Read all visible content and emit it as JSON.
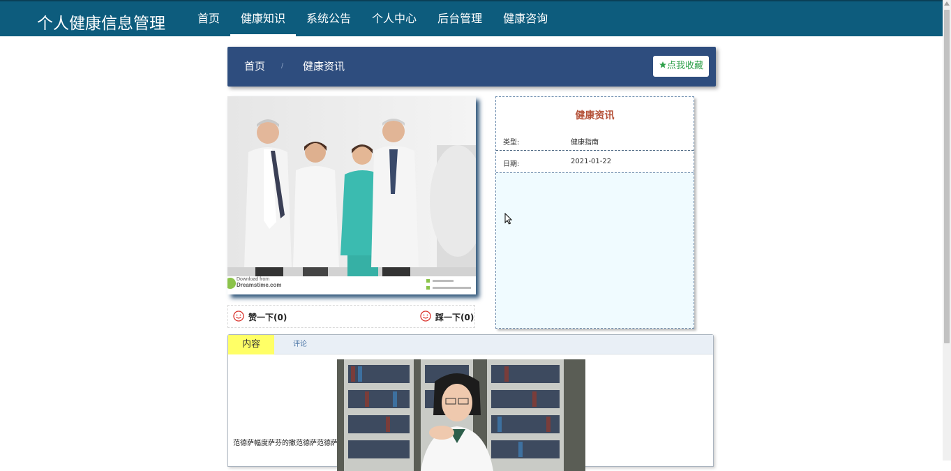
{
  "header": {
    "brand": "个人健康信息管理",
    "nav": [
      "首页",
      "健康知识",
      "系统公告",
      "个人中心",
      "后台管理",
      "健康咨询"
    ],
    "active_index": 1,
    "bg_color": "#0d5c7d"
  },
  "breadcrumb": {
    "home": "首页",
    "separator": "/",
    "current": "健康资讯",
    "favorite_label": "点我收藏",
    "favorite_icon": "star-icon",
    "bg_color": "#2e4d7e"
  },
  "article_image": {
    "watermark_line1": "Download from",
    "watermark_line2": "Dreamstime.com"
  },
  "reactions": {
    "like_label": "赞一下(0)",
    "dislike_label": "踩一下(0)",
    "icon": "smile-icon"
  },
  "info": {
    "title": "健康资讯",
    "rows": [
      {
        "key": "类型:",
        "value": "健康指南"
      },
      {
        "key": "日期:",
        "value": "2021-01-22"
      }
    ]
  },
  "tabs": {
    "items": [
      "内容",
      "评论"
    ],
    "active_index": 0
  },
  "content": {
    "text": "范德萨幅度萨芬的撒范德萨范德萨"
  }
}
